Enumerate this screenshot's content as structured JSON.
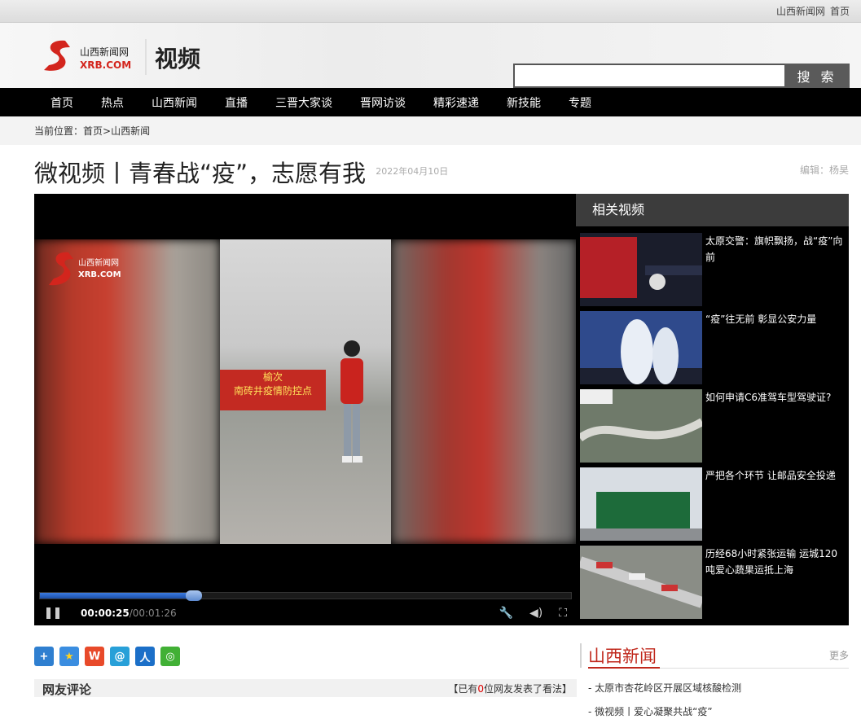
{
  "topbar": {
    "site_link": "山西新闻网",
    "home_link": "首页"
  },
  "logo": {
    "domain": "XRB.COM",
    "cn_name": "山西新闻网",
    "section": "视频"
  },
  "search": {
    "value": "",
    "button": "搜 索"
  },
  "nav": [
    "首页",
    "热点",
    "山西新闻",
    "直播",
    "三晋大家谈",
    "晋网访谈",
    "精彩速递",
    "新技能",
    "专题"
  ],
  "breadcrumb": {
    "label": "当前位置：",
    "home": "首页",
    "sep": ">",
    "current": "山西新闻"
  },
  "article": {
    "title": "微视频丨青春战“疫”，志愿有我",
    "date": "2022年04月10日",
    "editor": "编辑：杨昊"
  },
  "player": {
    "current_time": "00:00:25",
    "duration": "/00:01:26",
    "progress_fraction": 0.29,
    "frame_banner_top": "榆次",
    "frame_banner_main": "南砖井疫情防控点"
  },
  "related": {
    "title": "相关视频",
    "items": [
      "太原交警：旗帜飘扬，战“疫”向前",
      "“疫”往无前 彰显公安力量",
      "如何申请C6准驾车型驾驶证?",
      "严把各个环节 让邮品安全投递",
      "历经68小时紧张运输 运城120吨爱心蔬果运抵上海"
    ]
  },
  "share_icons": [
    "share-plus-icon",
    "favorite-star-icon",
    "weibo-icon",
    "tencent-weibo-icon",
    "renren-icon",
    "wechat-icon"
  ],
  "comments": {
    "heading": "网友评论",
    "prefix": "【已有",
    "count": "0",
    "suffix": "位网友发表了看法】"
  },
  "sx_news": {
    "title": "山西新闻",
    "more": "更多",
    "items": [
      "太原市杏花岭区开展区域核酸检测",
      "微视频丨爱心凝聚共战“疫”"
    ]
  },
  "colors": {
    "accent_red": "#c0281c",
    "nav_bg": "#000000",
    "progress_blue": "#2a63c4"
  }
}
